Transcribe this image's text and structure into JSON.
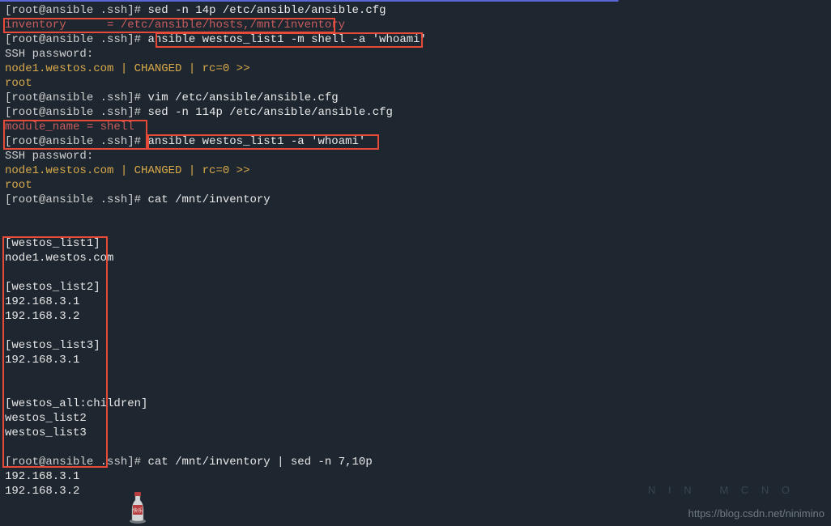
{
  "prompt": {
    "user": "root",
    "host": "ansible",
    "dir": ".ssh",
    "symbol": "#"
  },
  "lines": {
    "l1_cmd": "sed -n 14p /etc/ansible/ansible.cfg",
    "l2_out": "inventory      = /etc/ansible/hosts,/mnt/inventory",
    "l3_cmd_pre": "ansible westos_list1 -m shell -a 'whoami'",
    "l4": "SSH password:",
    "l5a": "node1.westos.com",
    "l5b": " | ",
    "l5c": "CHANGED",
    "l5d": " | rc=0 >>",
    "l6": "root",
    "l7_cmd": "vim /etc/ansible/ansible.cfg",
    "l8_cmd": "sed -n 114p /etc/ansible/ansible.cfg",
    "l9_out": "module_name = shell",
    "l10_cmd_full": "ansible westos_list1 -a 'whoami'",
    "l11": "SSH password:",
    "l12a": "node1.westos.com",
    "l12b": " | ",
    "l12c": "CHANGED",
    "l12d": " | rc=0 >>",
    "l13": "root",
    "l14_cmd": "cat /mnt/inventory",
    "inv1": "[westos_list1]",
    "inv2": "node1.westos.com",
    "inv3": "[westos_list2]",
    "inv4": "192.168.3.1",
    "inv5": "192.168.3.2",
    "inv6": "[westos_list3]",
    "inv7": "192.168.3.1",
    "inv8": "[westos_all:children]",
    "inv9": "westos_list2",
    "inv10": "westos_list3",
    "l_last_cmd": "cat /mnt/inventory | sed -n 7,10p",
    "out1": "192.168.3.1",
    "out2": "192.168.3.2"
  },
  "watermark": "https://blog.csdn.net/ninimino"
}
